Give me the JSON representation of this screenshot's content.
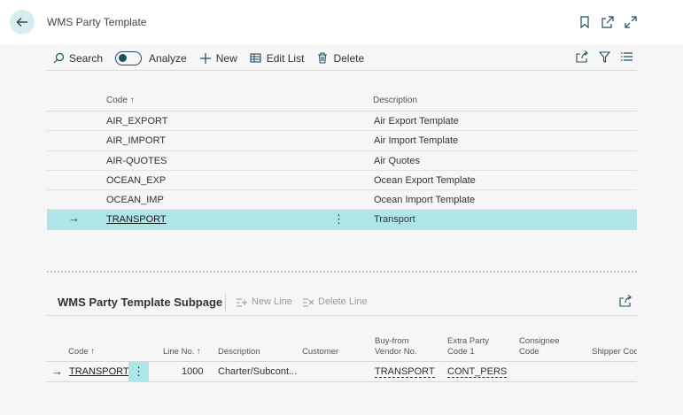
{
  "header": {
    "title": "WMS Party Template"
  },
  "actions": {
    "search": "Search",
    "analyze": "Analyze",
    "new": "New",
    "edit_list": "Edit List",
    "delete": "Delete"
  },
  "list": {
    "columns": {
      "code": "Code ↑",
      "description": "Description"
    },
    "rows": [
      {
        "code": "AIR_EXPORT",
        "description": "Air Export Template"
      },
      {
        "code": "AIR_IMPORT",
        "description": "Air Import Template"
      },
      {
        "code": "AIR-QUOTES",
        "description": "Air Quotes"
      },
      {
        "code": "OCEAN_EXP",
        "description": "Ocean Export Template"
      },
      {
        "code": "OCEAN_IMP",
        "description": "Ocean Import Template"
      },
      {
        "code": "TRANSPORT",
        "description": "Transport",
        "selected": true
      }
    ],
    "row_arrow": "→",
    "row_menu": "⋮"
  },
  "subpage": {
    "title": "WMS Party Template Subpage",
    "new_line": "New Line",
    "delete_line": "Delete Line",
    "columns": {
      "code": "Code ↑",
      "line_no": "Line No. ↑",
      "description": "Description",
      "customer": "Customer",
      "buy_from_1": "Buy-from",
      "buy_from_2": "Vendor No.",
      "extra_party_1": "Extra Party",
      "extra_party_2": "Code 1",
      "consignee_1": "Consignee",
      "consignee_2": "Code",
      "shipper": "Shipper Code"
    },
    "row": {
      "arrow": "→",
      "code": "TRANSPORT",
      "menu": "⋮",
      "line_no": "1000",
      "description": "Charter/Subcont...",
      "customer": "",
      "buy_from": "TRANSPORT",
      "extra_party": "CONT_PERS",
      "consignee": "",
      "shipper": ""
    }
  },
  "colors": {
    "accent": "#1f4e5c",
    "selected_row": "#aee5e8",
    "back_button": "#d7eeee"
  }
}
